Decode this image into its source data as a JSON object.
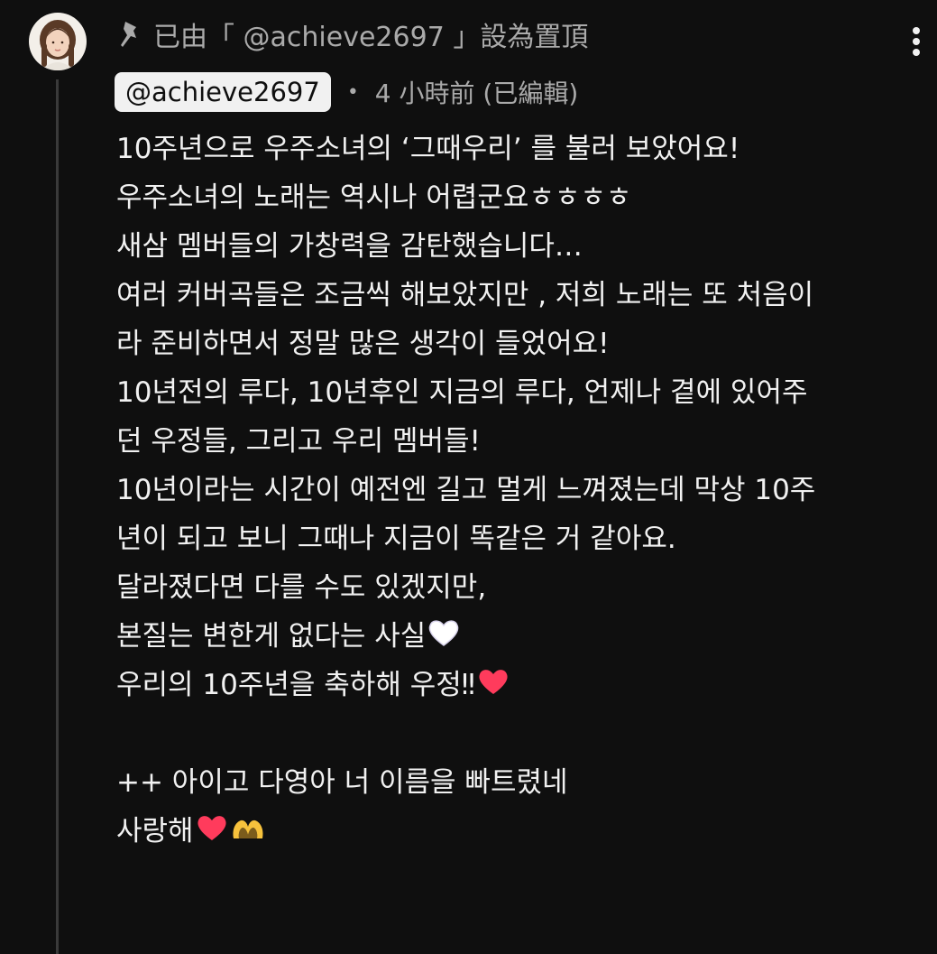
{
  "comment": {
    "pinned_label": "已由「 @achieve2697 」設為置頂",
    "author": "@achieve2697",
    "timestamp": "4 小時前 (已編輯)",
    "lines": [
      "10주년으로 우주소녀의 ‘그때우리’ 를 불러 보았어요!",
      "우주소녀의 노래는 역시나 어렵군요ㅎㅎㅎㅎ",
      "새삼 멤버들의 가창력을 감탄했습니다…",
      "여러 커버곡들은 조금씩 해보았지만 , 저희 노래는 또 처음이",
      "라 준비하면서 정말 많은 생각이 들었어요!",
      "10년전의 루다, 10년후인 지금의 루다, 언제나 곁에 있어주",
      "던 우정들, 그리고 우리 멤버들!",
      "10년이라는 시간이 예전엔 길고 멀게 느껴졌는데 막상 10주",
      "년이 되고 보니 그때나 지금이 똑같은 거 같아요.",
      "달라졌다면 다를 수도 있겠지만,",
      "본질는 변한게 없다는 사실",
      "우리의 10주년을 축하해 우정‼",
      "",
      "++ 아이고 다영아 너 이름을 빠트렸네",
      "사랑해"
    ]
  },
  "icons": {
    "pin": "pin-icon",
    "menu": "more-vertical-icon",
    "white_heart": "white-heart-icon",
    "red_heart": "red-heart-icon",
    "heart_hands": "heart-hands-icon"
  },
  "colors": {
    "background": "#0f0f0f",
    "text": "#f1f1f1",
    "secondary_text": "#aaaaaa",
    "author_chip_bg": "#f1f1f1",
    "thread_line": "#3a3a3a",
    "red_heart": "#ff3b5c"
  }
}
